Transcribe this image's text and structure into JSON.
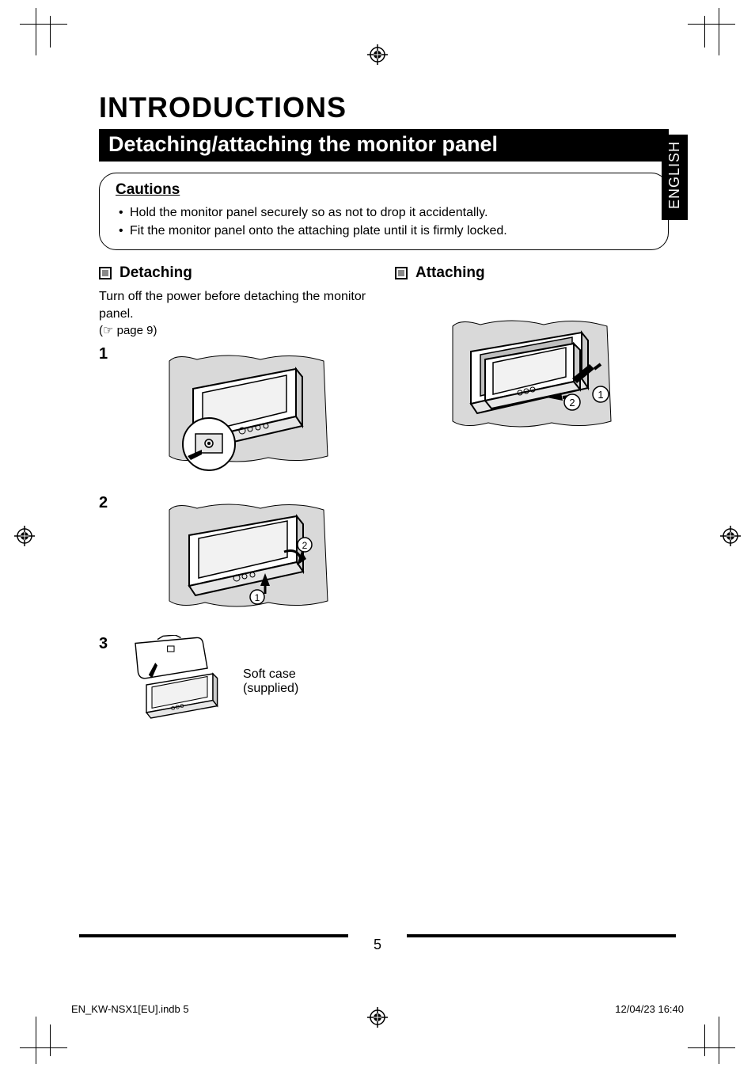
{
  "language_tab": "ENGLISH",
  "title": "INTRODUCTIONS",
  "subtitle": "Detaching/attaching the monitor panel",
  "cautions": {
    "heading": "Cautions",
    "items": [
      "Hold the monitor panel securely so as not to drop it accidentally.",
      "Fit the monitor panel onto the attaching plate until it is firmly locked."
    ]
  },
  "detaching": {
    "heading": "Detaching",
    "intro": "Turn off the power before detaching the monitor panel.",
    "page_ref": "(☞ page 9)",
    "steps": [
      "1",
      "2",
      "3"
    ],
    "soft_case_label": "Soft case (supplied)"
  },
  "attaching": {
    "heading": "Attaching"
  },
  "page_number": "5",
  "footer": {
    "file": "EN_KW-NSX1[EU].indb   5",
    "timestamp": "12/04/23   16:40"
  }
}
